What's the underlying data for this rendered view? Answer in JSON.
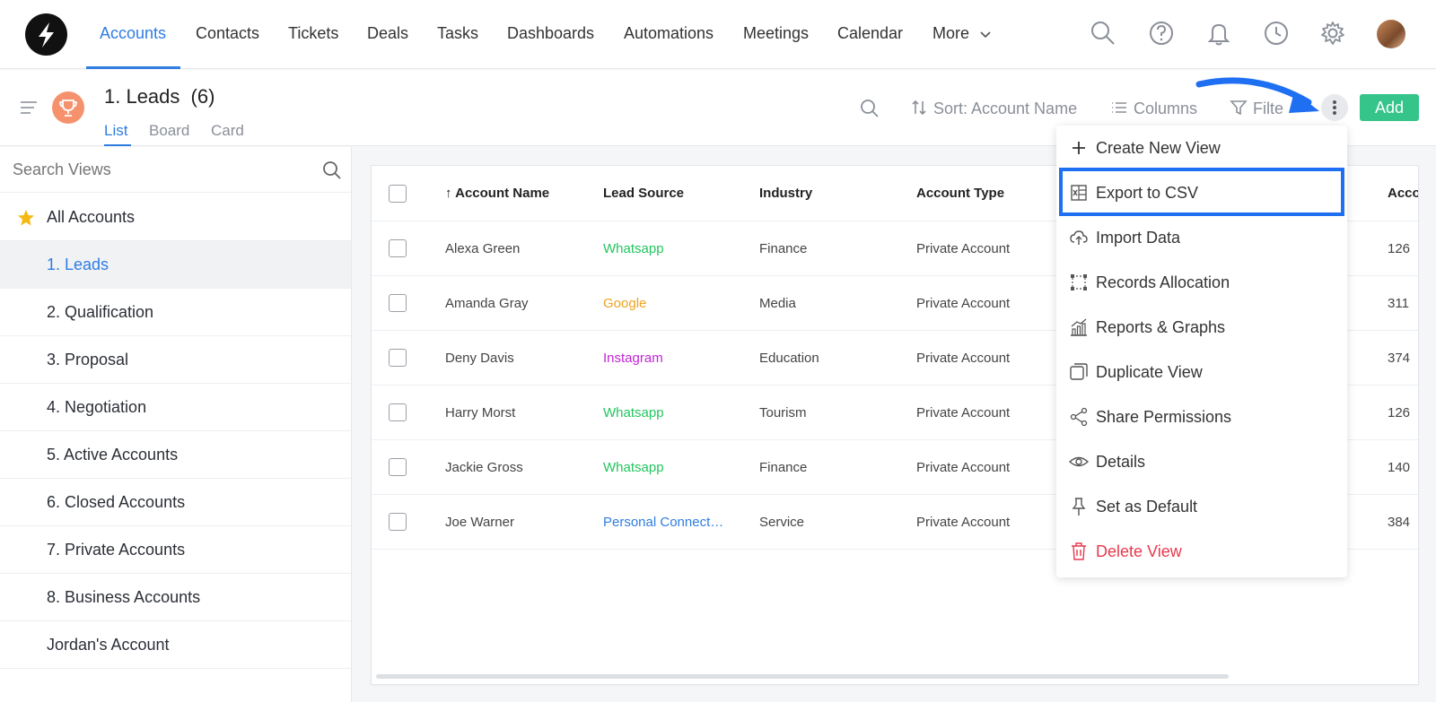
{
  "nav": {
    "items": [
      "Accounts",
      "Contacts",
      "Tickets",
      "Deals",
      "Tasks",
      "Dashboards",
      "Automations",
      "Meetings",
      "Calendar",
      "More"
    ],
    "active": "Accounts"
  },
  "view": {
    "title": "1. Leads",
    "count": "(6)",
    "tabs": [
      "List",
      "Board",
      "Card"
    ],
    "active_tab": "List"
  },
  "toolbar": {
    "sort_label": "Sort: Account Name",
    "columns_label": "Columns",
    "filter_label": "Filte",
    "add_label": "Add"
  },
  "sidebar": {
    "search_placeholder": "Search Views",
    "items": [
      "All Accounts",
      "1. Leads",
      "2. Qualification",
      "3. Proposal",
      "4. Negotiation",
      "5. Active Accounts",
      "6. Closed Accounts",
      "7. Private Accounts",
      "8. Business Accounts",
      "Jordan's Account"
    ],
    "selected": "1. Leads"
  },
  "table": {
    "headers": [
      "Account Name",
      "Lead Source",
      "Industry",
      "Account Type",
      "Acco"
    ],
    "sort_indicator": "↑",
    "rows": [
      [
        "Alexa Green",
        "Whatsapp",
        "Finance",
        "Private Account",
        "126"
      ],
      [
        "Amanda Gray",
        "Google",
        "Media",
        "Private Account",
        "311"
      ],
      [
        "Deny Davis",
        "Instagram",
        "Education",
        "Private Account",
        "374"
      ],
      [
        "Harry Morst",
        "Whatsapp",
        "Tourism",
        "Private Account",
        "126"
      ],
      [
        "Jackie Gross",
        "Whatsapp",
        "Finance",
        "Private Account",
        "140"
      ],
      [
        "Joe Warner",
        "Personal Connect…",
        "Service",
        "Private Account",
        "384"
      ]
    ],
    "source_colors": {
      "Whatsapp": "#22c55e",
      "Google": "#f0a21c",
      "Instagram": "#c026d3",
      "Personal Connect…": "#2f7de1"
    }
  },
  "menu": {
    "items": [
      {
        "label": "Create New View",
        "icon": "plus-icon"
      },
      {
        "label": "Export to CSV",
        "icon": "csv-file-icon"
      },
      {
        "label": "Import Data",
        "icon": "cloud-upload-icon"
      },
      {
        "label": "Records Allocation",
        "icon": "allocation-icon"
      },
      {
        "label": "Reports & Graphs",
        "icon": "bar-chart-icon"
      },
      {
        "label": "Duplicate View",
        "icon": "duplicate-icon"
      },
      {
        "label": "Share Permissions",
        "icon": "share-icon"
      },
      {
        "label": "Details",
        "icon": "eye-icon"
      },
      {
        "label": "Set as Default",
        "icon": "pin-icon"
      },
      {
        "label": "Delete View",
        "icon": "trash-icon"
      }
    ],
    "highlighted": "Export to CSV"
  },
  "colors": {
    "accent": "#2f7de1",
    "add_button": "#35c489",
    "danger": "#e8394d",
    "highlight_box": "#1f6ff2"
  }
}
